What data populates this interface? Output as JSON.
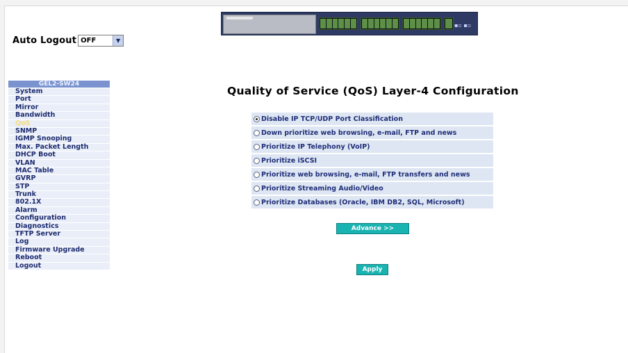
{
  "autologout": {
    "label": "Auto Logout",
    "value": "OFF"
  },
  "sidebar": {
    "header": "GEL2-SW24",
    "items": [
      {
        "label": "System"
      },
      {
        "label": "Port"
      },
      {
        "label": "Mirror"
      },
      {
        "label": "Bandwidth"
      },
      {
        "label": "QoS",
        "active": true
      },
      {
        "label": "SNMP"
      },
      {
        "label": "IGMP Snooping"
      },
      {
        "label": "Max. Packet Length"
      },
      {
        "label": "DHCP Boot"
      },
      {
        "label": "VLAN"
      },
      {
        "label": "MAC Table"
      },
      {
        "label": "GVRP"
      },
      {
        "label": "STP"
      },
      {
        "label": "Trunk"
      },
      {
        "label": "802.1X"
      },
      {
        "label": "Alarm"
      },
      {
        "label": "Configuration"
      },
      {
        "label": "Diagnostics"
      },
      {
        "label": "TFTP Server"
      },
      {
        "label": "Log"
      },
      {
        "label": "Firmware Upgrade"
      },
      {
        "label": "Reboot"
      },
      {
        "label": "Logout"
      }
    ]
  },
  "main": {
    "title": "Quality of Service (QoS) Layer-4 Configuration",
    "options": [
      {
        "label": "Disable IP TCP/UDP Port Classification",
        "checked": true
      },
      {
        "label": "Down prioritize web browsing, e-mail, FTP and news",
        "checked": false
      },
      {
        "label": "Prioritize IP Telephony (VoIP)",
        "checked": false
      },
      {
        "label": "Prioritize iSCSI",
        "checked": false
      },
      {
        "label": "Prioritize web browsing, e-mail, FTP transfers and news",
        "checked": false
      },
      {
        "label": "Prioritize Streaming Audio/Video",
        "checked": false
      },
      {
        "label": "Prioritize Databases (Oracle, IBM DB2, SQL, Microsoft)",
        "checked": false
      }
    ],
    "advance_label": "Advance >>",
    "apply_label": "Apply"
  },
  "colors": {
    "sidebar_header": "#7a93cf",
    "sidebar_item_bg": "#e9eef9",
    "sidebar_text": "#1e2c6e",
    "active_item": "#f2dc7e",
    "option_bg": "#dde6f2",
    "button_bg": "#19b3b1"
  }
}
